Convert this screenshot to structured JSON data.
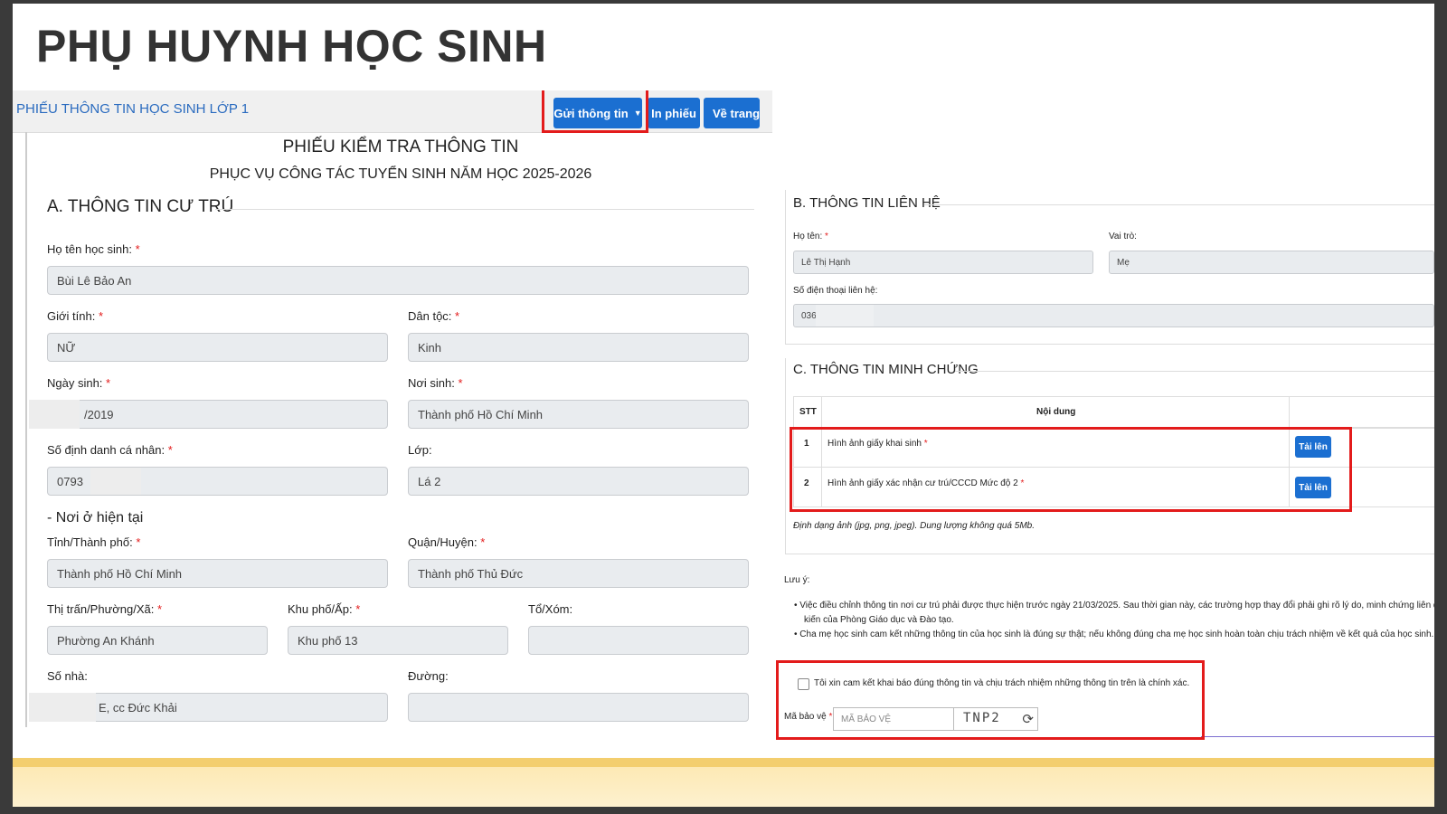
{
  "slide": {
    "title": "PHỤ HUYNH HỌC SINH"
  },
  "left": {
    "breadcrumb": "PHIẾU THÔNG TIN HỌC SINH LỚP 1",
    "buttons": {
      "send": "Gửi thông tin",
      "print": "In phiếu",
      "home": "Về trang c"
    },
    "doc_title": "PHIẾU KIỂM TRA THÔNG TIN",
    "doc_subtitle": "PHỤC VỤ CÔNG TÁC TUYỂN SINH NĂM HỌC 2025-2026",
    "section_a": "A. THÔNG TIN CƯ TRÚ",
    "fields": {
      "student_name": {
        "label": "Họ tên học sinh:",
        "value": "Bùi Lê Bảo An"
      },
      "gender": {
        "label": "Giới tính:",
        "value": "NỮ"
      },
      "ethnicity": {
        "label": "Dân tộc:",
        "value": "Kinh"
      },
      "dob": {
        "label": "Ngày sinh:",
        "value": "/2019"
      },
      "birthplace": {
        "label": "Nơi sinh:",
        "value": "Thành phố Hồ Chí Minh"
      },
      "id_number": {
        "label": "Số định danh cá nhân:",
        "value": "0793"
      },
      "class": {
        "label": "Lớp:",
        "value": "Lá 2"
      },
      "residence_heading": "- Nơi ở hiện tại",
      "province": {
        "label": "Tỉnh/Thành phố:",
        "value": "Thành phố Hồ Chí Minh"
      },
      "district": {
        "label": "Quận/Huyện:",
        "value": "Thành phố Thủ Đức"
      },
      "ward": {
        "label": "Thị trấn/Phường/Xã:",
        "value": "Phường An Khánh"
      },
      "quarter": {
        "label": "Khu phố/Ấp:",
        "value": "Khu phố 13"
      },
      "hamlet": {
        "label": "Tổ/Xóm:",
        "value": ""
      },
      "house_no": {
        "label": "Số nhà:",
        "value": "E, cc Đức Khải"
      },
      "street": {
        "label": "Đường:",
        "value": ""
      }
    },
    "required_mark": "*"
  },
  "right": {
    "section_b": "B. THÔNG TIN LIÊN HỆ",
    "contact_name": {
      "label": "Họ tên:",
      "value": "Lê Thị Hạnh"
    },
    "role": {
      "label": "Vai trò:",
      "value": "Mẹ"
    },
    "phone": {
      "label": "Số điện thoại liên hệ:",
      "value": "036"
    },
    "section_c": "C. THÔNG TIN MINH CHỨNG",
    "table": {
      "headers": [
        "STT",
        "Nội dung"
      ],
      "rows": [
        {
          "stt": "1",
          "content": "Hình ảnh giấy khai sinh",
          "button": "Tải lên"
        },
        {
          "stt": "2",
          "content": "Hình ảnh giấy xác nhận cư trú/CCCD Mức độ 2",
          "button": "Tải lên"
        }
      ]
    },
    "format_note": "Định dạng ảnh (jpg, png, jpeg). Dung lượng không quá 5Mb.",
    "note_title": "Lưu ý:",
    "notes": [
      "Việc điều chỉnh thông tin nơi cư trú phải được thực hiện trước ngày 21/03/2025. Sau thời gian này, các trường hợp thay đổi phải ghi rõ lý do, minh chứng liên quan và ý",
      "kiến của Phòng Giáo dục và Đào tạo.",
      "Cha mẹ học sinh cam kết những thông tin của học sinh là đúng sự thật; nếu không đúng cha mẹ học sinh hoàn toàn chịu trách nhiệm về kết quả của học sinh."
    ],
    "commit_text": "Tôi xin cam kết khai báo đúng thông tin và chịu trách nhiệm những thông tin trên là chính xác.",
    "captcha": {
      "label": "Mã bảo vệ",
      "placeholder": "MÃ BẢO VỆ",
      "code": "TNP2",
      "refresh_icon": "refresh-icon"
    }
  }
}
